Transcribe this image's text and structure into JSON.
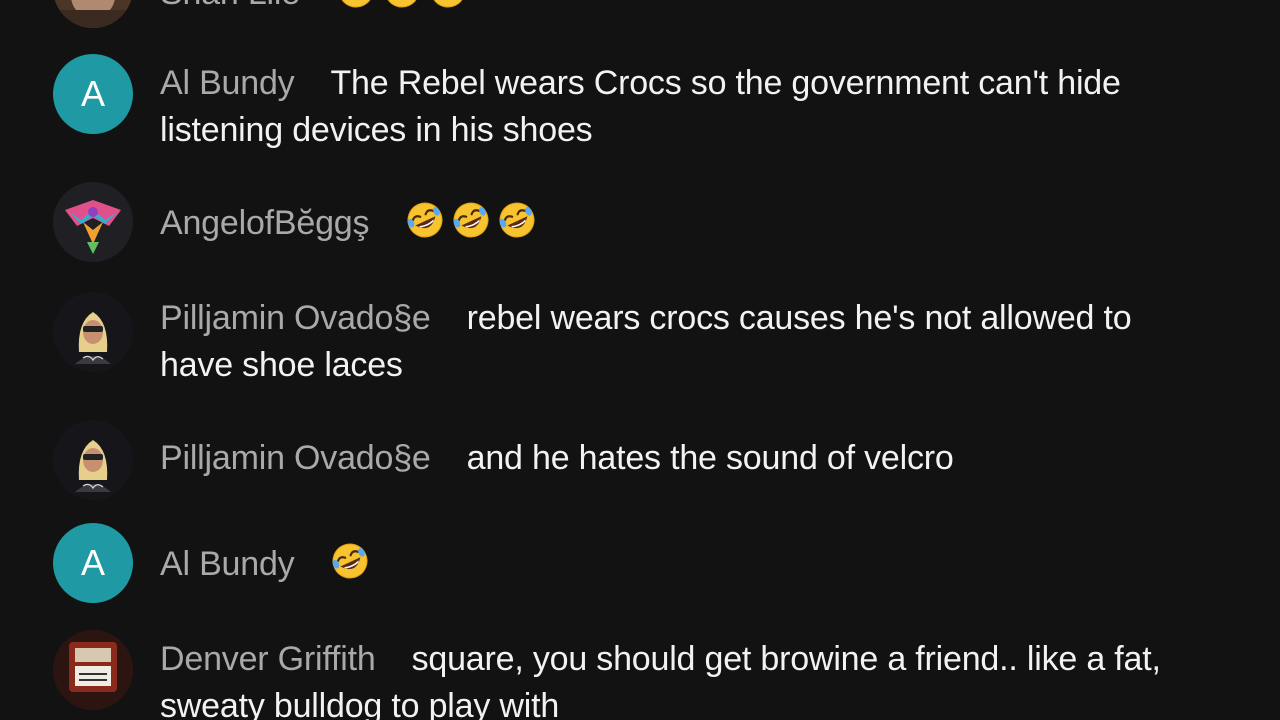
{
  "messages": [
    {
      "author": "Shan Lile",
      "text": "",
      "emoji_count": 3,
      "avatar": "photo"
    },
    {
      "author": "Al Bundy",
      "text": "The Rebel wears Crocs so the government can't hide listening devices in his shoes",
      "avatar_letter": "A"
    },
    {
      "author": "AngelofBĕggş",
      "text": "",
      "emoji_count": 3,
      "avatar": "colorful-bird"
    },
    {
      "author": "Pilljamin Ovado§e",
      "text": "rebel wears crocs causes he's not allowed to have shoe laces",
      "avatar": "bounty-hunter"
    },
    {
      "author": "Pilljamin Ovado§e",
      "text": "and he hates the sound of velcro",
      "avatar": "bounty-hunter"
    },
    {
      "author": "Al Bundy",
      "text": "",
      "emoji_count": 1,
      "avatar_letter": "A"
    },
    {
      "author": "Denver Griffith",
      "text": "square, you should get browine a friend.. like a fat, sweaty bulldog to play with",
      "avatar": "duck-sign"
    }
  ],
  "emoji": "rolling-on-floor-laughing-emoji",
  "colors": {
    "background": "#121212",
    "author": "#a9a9a9",
    "message": "#f2f2f2",
    "letter_avatar": "#1f9aa5"
  }
}
